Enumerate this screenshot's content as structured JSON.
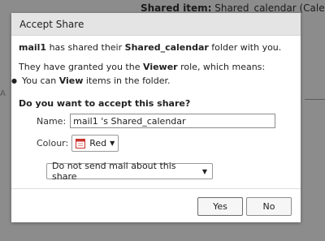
{
  "background": {
    "shared_item_label": "Shared item:",
    "shared_item_value": "Shared_calendar (Cale",
    "stray_text": "A"
  },
  "dialog": {
    "title": "Accept Share",
    "sharer": "mail1",
    "message_mid": " has shared their ",
    "folder": "Shared_calendar",
    "message_end": " folder with you.",
    "role_prefix": "They have granted you the ",
    "role": "Viewer",
    "role_suffix": " role, which means:",
    "bullet_prefix": "You can ",
    "bullet_verb": "View",
    "bullet_suffix": " items in the folder.",
    "question": "Do you want to accept this share?",
    "name_label": "Name:",
    "name_value": "mail1 's Shared_calendar",
    "colour_label": "Colour:",
    "colour_value": "Red",
    "mail_option": "Do not send mail about this share",
    "yes_label": "Yes",
    "no_label": "No"
  },
  "colors": {
    "calendar_red": "#c8322c"
  },
  "icons": [
    "calendar-icon",
    "dropdown-caret-icon"
  ]
}
